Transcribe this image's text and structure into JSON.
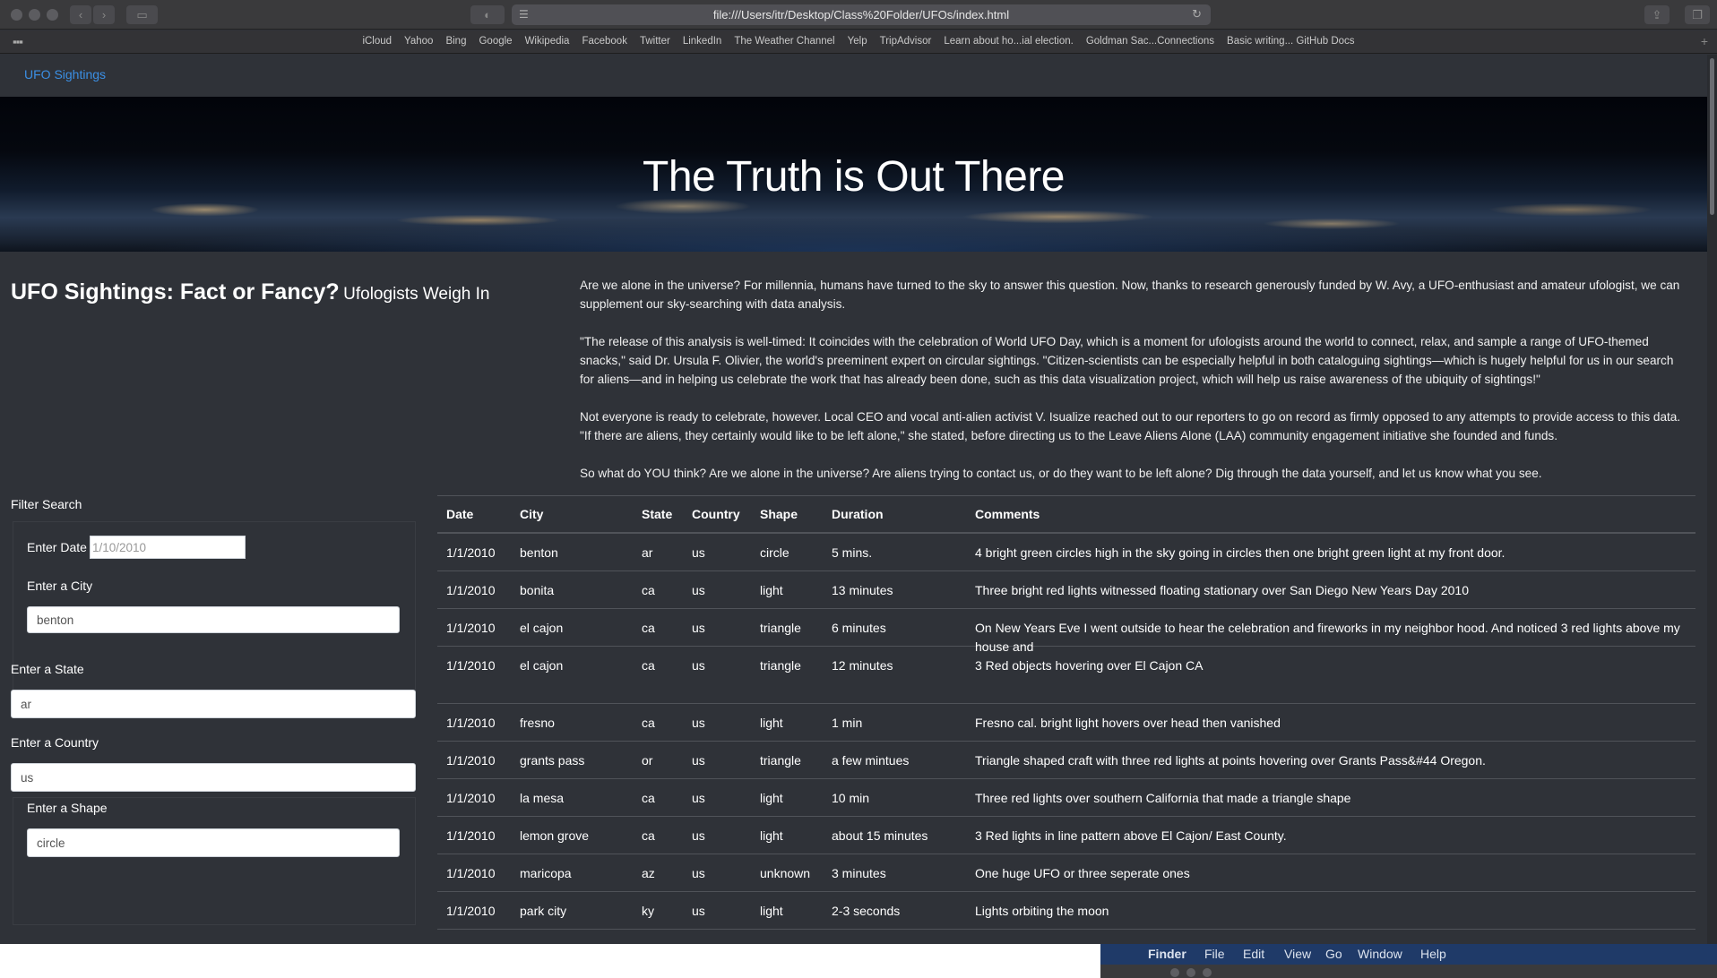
{
  "browser": {
    "url": "file:///Users/itr/Desktop/Class%20Folder/UFOs/index.html",
    "favorites": [
      "iCloud",
      "Yahoo",
      "Bing",
      "Google",
      "Wikipedia",
      "Facebook",
      "Twitter",
      "LinkedIn",
      "The Weather Channel",
      "Yelp",
      "TripAdvisor",
      "Learn about ho...ial election.",
      "Goldman Sac...Connections",
      "Basic writing... GitHub Docs"
    ]
  },
  "nav": {
    "brand": "UFO Sightings"
  },
  "hero": {
    "title": "The Truth is Out There"
  },
  "article": {
    "heading": "UFO Sightings: Fact or Fancy?",
    "subheading": "Ufologists Weigh In",
    "paragraphs": [
      "Are we alone in the universe? For millennia, humans have turned to the sky to answer this question. Now, thanks to research generously funded by W. Avy, a UFO-enthusiast and amateur ufologist, we can supplement our sky-searching with data analysis.",
      "\"The release of this analysis is well-timed: It coincides with the celebration of World UFO Day, which is a moment for ufologists around the world to connect, relax, and sample a range of UFO-themed snacks,\" said Dr. Ursula F. Olivier, the world's preeminent expert on circular sightings. \"Citizen-scientists can be especially helpful in both cataloguing sightings—which is hugely helpful for us in our search for aliens—and in helping us celebrate the work that has already been done, such as this data visualization project, which will help us raise awareness of the ubiquity of sightings!\"",
      "Not everyone is ready to celebrate, however. Local CEO and vocal anti-alien activist V. Isualize reached out to our reporters to go on record as firmly opposed to any attempts to provide access to this data. \"If there are aliens, they certainly would like to be left alone,\" she stated, before directing us to the Leave Aliens Alone (LAA) community engagement initiative she founded and funds.",
      "So what do YOU think? Are we alone in the universe? Are aliens trying to contact us, or do they want to be left alone? Dig through the data yourself, and let us know what you see."
    ]
  },
  "filters": {
    "title": "Filter Search",
    "date": {
      "label": "Enter Date",
      "placeholder": "1/10/2010"
    },
    "city": {
      "label": "Enter a City",
      "placeholder": "benton"
    },
    "state": {
      "label": "Enter a State",
      "placeholder": "ar"
    },
    "country": {
      "label": "Enter a Country",
      "placeholder": "us"
    },
    "shape": {
      "label": "Enter a Shape",
      "placeholder": "circle"
    }
  },
  "table": {
    "headers": [
      "Date",
      "City",
      "State",
      "Country",
      "Shape",
      "Duration",
      "Comments"
    ],
    "rows": [
      [
        "1/1/2010",
        "benton",
        "ar",
        "us",
        "circle",
        "5 mins.",
        "4 bright green circles high in the sky going in circles then one bright green light at my front door."
      ],
      [
        "1/1/2010",
        "bonita",
        "ca",
        "us",
        "light",
        "13 minutes",
        "Three bright red lights witnessed floating stationary over San Diego New Years Day 2010"
      ],
      [
        "1/1/2010",
        "el cajon",
        "ca",
        "us",
        "triangle",
        "6 minutes",
        "On New Years Eve I went outside to hear the celebration and fireworks in my neighbor hood. And noticed 3 red lights above my house and"
      ],
      [
        "1/1/2010",
        "el cajon",
        "ca",
        "us",
        "triangle",
        "12 minutes",
        "3 Red objects hovering over El Cajon CA"
      ],
      [
        "1/1/2010",
        "fresno",
        "ca",
        "us",
        "light",
        "1 min",
        "Fresno cal. bright light hovers over head then vanished"
      ],
      [
        "1/1/2010",
        "grants pass",
        "or",
        "us",
        "triangle",
        "a few mintues",
        "Triangle shaped craft with three red lights at points hovering over Grants Pass&#44 Oregon."
      ],
      [
        "1/1/2010",
        "la mesa",
        "ca",
        "us",
        "light",
        "10 min",
        "Three red lights over southern California that made a triangle shape"
      ],
      [
        "1/1/2010",
        "lemon grove",
        "ca",
        "us",
        "light",
        "about 15 minutes",
        "3 Red lights in line pattern above El Cajon/ East County."
      ],
      [
        "1/1/2010",
        "maricopa",
        "az",
        "us",
        "unknown",
        "3 minutes",
        "One huge UFO or three seperate ones"
      ],
      [
        "1/1/2010",
        "park city",
        "ky",
        "us",
        "light",
        "2-3 seconds",
        "Lights orbiting the moon"
      ]
    ]
  },
  "macos_menubar": [
    "Finder",
    "File",
    "Edit",
    "View",
    "Go",
    "Window",
    "Help"
  ],
  "colors": {
    "page_bg": "#2f3238",
    "brand_link": "#3b8fe4",
    "menubar": "#1f3a68"
  }
}
